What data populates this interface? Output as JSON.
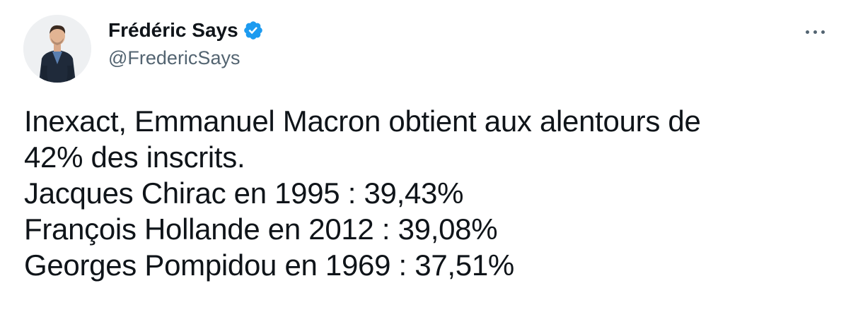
{
  "tweet": {
    "author": {
      "display_name": "Frédéric Says",
      "handle": "@FredericSays",
      "verified": true,
      "verified_color": "#1d9bf0"
    },
    "more_icon": "more-horizontal-icon",
    "text_lines": [
      "Inexact, Emmanuel Macron obtient aux alentours de",
      "42% des inscrits.",
      "Jacques Chirac en 1995 : 39,43%",
      "François Hollande en 2012 : 39,08%",
      "Georges Pompidou en 1969 : 37,51%"
    ]
  },
  "colors": {
    "text_primary": "#0f1419",
    "text_secondary": "#536471",
    "background": "#ffffff"
  }
}
